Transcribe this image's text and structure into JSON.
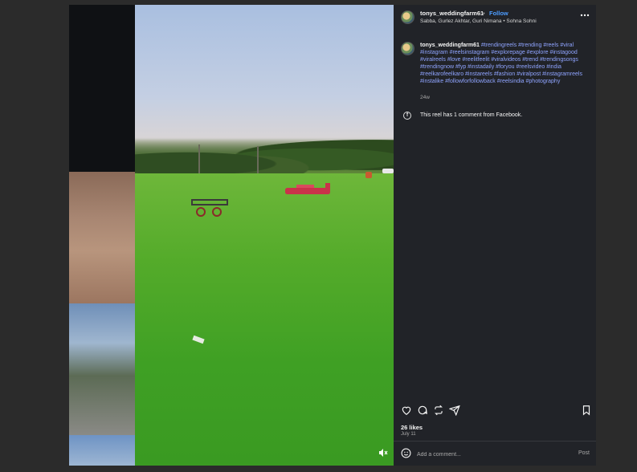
{
  "post": {
    "username": "tonys_weddingfarm61",
    "separator": "•",
    "follow_label": "Follow",
    "audio": "Sabba, Gurlez Akhtar, Guri Nimana • Sohna Sohni",
    "more_icon": "more-horizontal-icon"
  },
  "caption": {
    "username": "tonys_weddingfarm61",
    "hashtags": "#trendingreels #trending #reels #viral #instagram #reelsinstagram #explorepage #explore #instagood #viralreels #love #reelitfeelit #viralvideos #trend #trendingsongs #trendingnow #fyp #instadaily #foryou #reelsvideo #india #reelkarofeelkaro #instareels #fashion #viralpost #instagramreels #instalike #followforfollowback #reelsindia #photography",
    "time": "24w"
  },
  "facebook_note": {
    "text": "This reel has 1 comment from Facebook."
  },
  "engagement": {
    "likes": "26 likes",
    "date": "July 11"
  },
  "comment_box": {
    "placeholder": "Add a comment...",
    "post_label": "Post"
  },
  "video": {
    "mute_icon": "volume-muted-icon"
  },
  "colors": {
    "panel_bg": "#212328",
    "link": "#8fa4ff",
    "follow": "#4d9dff",
    "page_bg": "#2b2b2b"
  }
}
